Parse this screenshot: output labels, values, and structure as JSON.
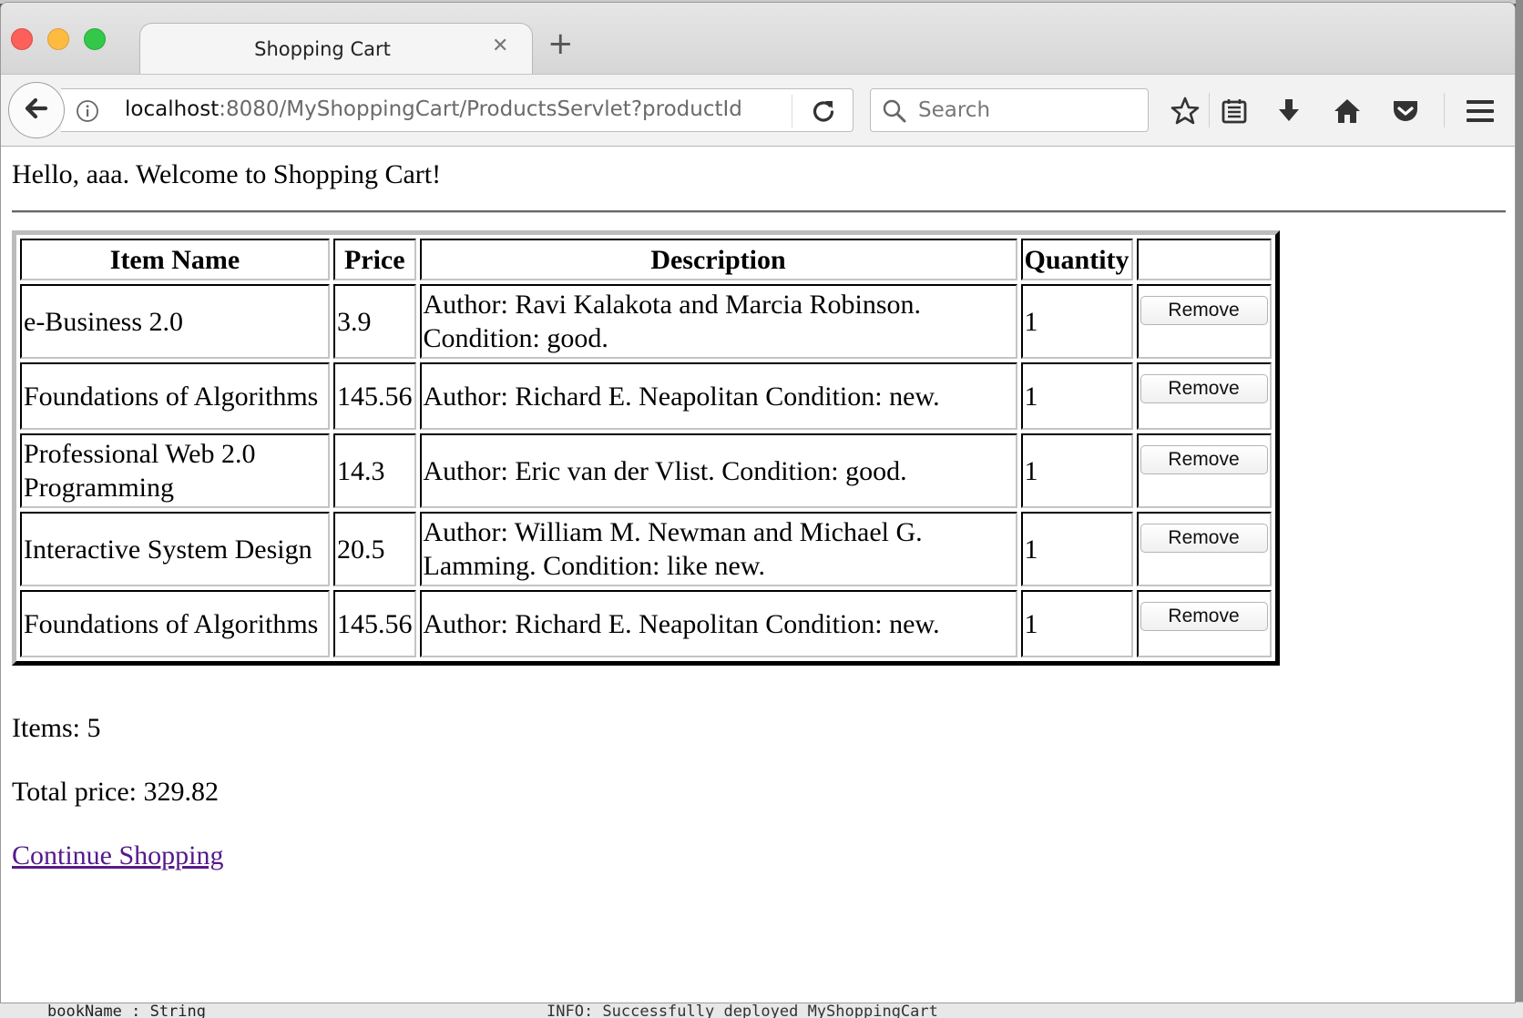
{
  "browser": {
    "tab_title": "Shopping Cart",
    "url_host": "localhost",
    "url_rest": ":8080/MyShoppingCart/ProductsServlet?productId",
    "search_placeholder": "Search"
  },
  "page": {
    "greeting": "Hello, aaa. Welcome to Shopping Cart!",
    "table": {
      "headers": [
        "Item Name",
        "Price",
        "Description",
        "Quantity",
        ""
      ],
      "rows": [
        {
          "name": "e-Business 2.0",
          "price": "3.9",
          "description": "Author: Ravi Kalakota and Marcia Robinson. Condition: good.",
          "quantity": "1",
          "action": "Remove"
        },
        {
          "name": "Foundations of Algorithms",
          "price": "145.56",
          "description": "Author: Richard E. Neapolitan Condition: new.",
          "quantity": "1",
          "action": "Remove"
        },
        {
          "name": "Professional Web 2.0 Programming",
          "price": "14.3",
          "description": "Author: Eric van der Vlist. Condition: good.",
          "quantity": "1",
          "action": "Remove"
        },
        {
          "name": "Interactive System Design",
          "price": "20.5",
          "description": "Author: William M. Newman and Michael G. Lamming. Condition: like new.",
          "quantity": "1",
          "action": "Remove"
        },
        {
          "name": "Foundations of Algorithms",
          "price": "145.56",
          "description": "Author: Richard E. Neapolitan Condition: new.",
          "quantity": "1",
          "action": "Remove"
        }
      ]
    },
    "items_count": "Items: 5",
    "total_price": "Total price: 329.82",
    "continue_link": "Continue Shopping"
  },
  "background": {
    "bottom_fragment_left": "bookName : String",
    "bottom_fragment_right": "INFO: Successfully deployed MyShoppingCart"
  },
  "colors": {
    "link_visited": "#551a8b",
    "close": "#fc605b",
    "minimize": "#fdbc40",
    "maximize": "#34c84a"
  },
  "icons": [
    "back-arrow-icon",
    "info-icon",
    "reload-icon",
    "search-icon",
    "star-icon",
    "reading-list-icon",
    "download-icon",
    "home-icon",
    "pocket-icon",
    "hamburger-menu-icon",
    "close-icon",
    "plus-icon"
  ]
}
